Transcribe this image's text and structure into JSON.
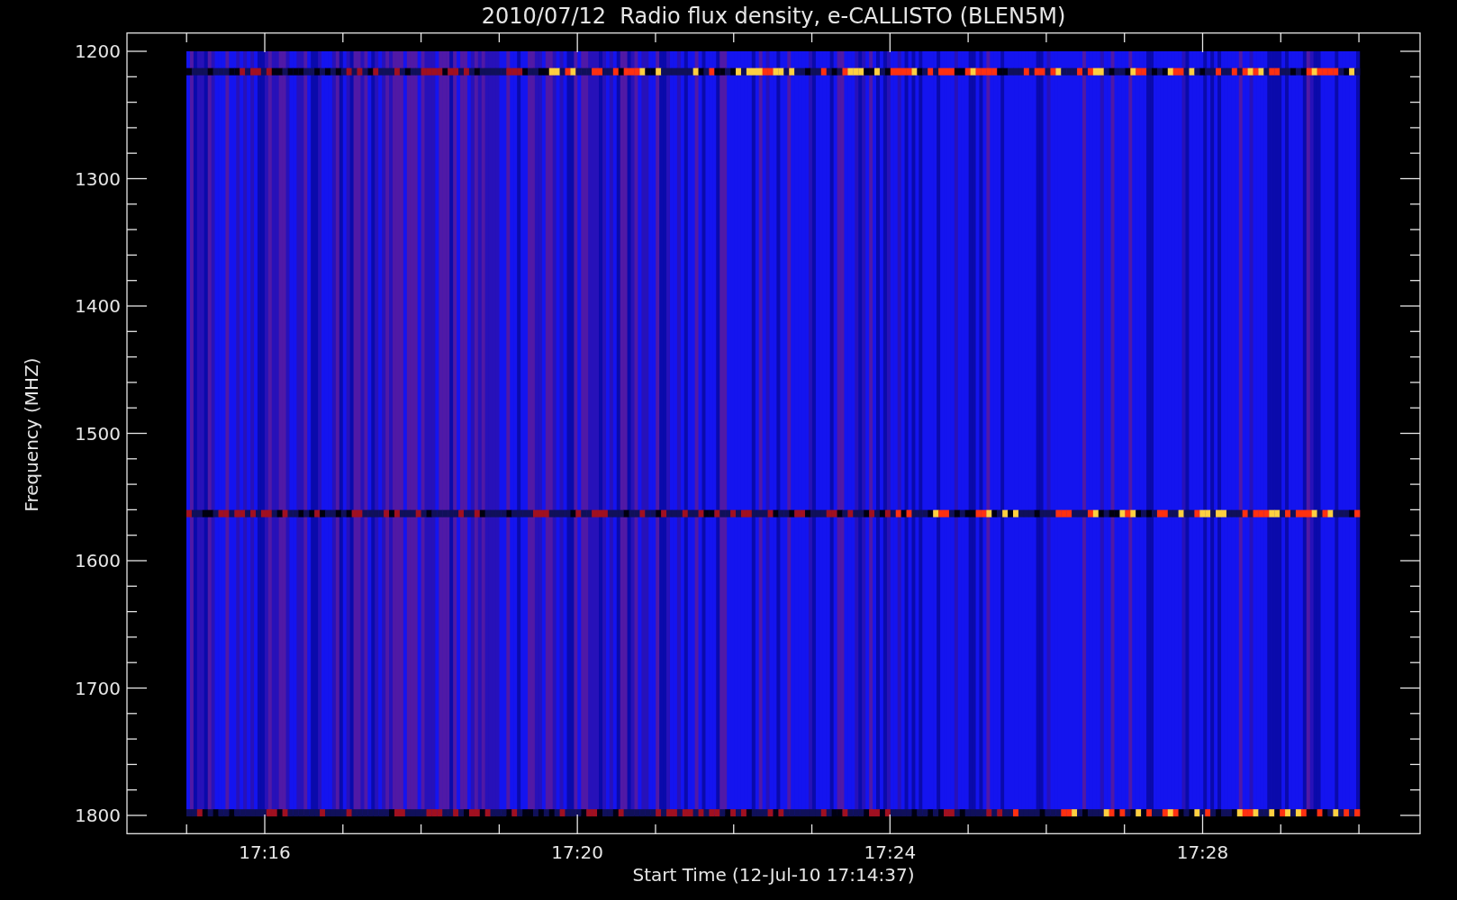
{
  "title": "2010/07/12  Radio flux density, e-CALLISTO (BLEN5M)",
  "y_axis": {
    "label": "Frequency (MHZ)",
    "ticks": [
      "1200",
      "1300",
      "1400",
      "1500",
      "1600",
      "1700",
      "1800"
    ]
  },
  "x_axis": {
    "label": "Start Time (12-Jul-10 17:14:37)",
    "ticks": [
      "17:16",
      "17:20",
      "17:24",
      "17:28"
    ]
  }
}
